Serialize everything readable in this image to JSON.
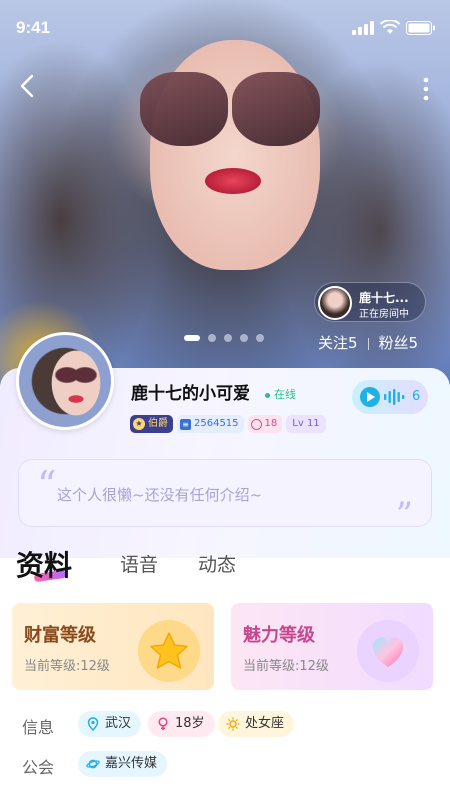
{
  "status_bar": {
    "time": "9:41"
  },
  "live": {
    "name": "鹿十七...",
    "status": "正在房间中"
  },
  "stats": {
    "follow": "关注5",
    "fans": "粉丝5"
  },
  "profile": {
    "nickname": "鹿十七的小可爱",
    "online": "在线",
    "badges": {
      "title": "伯爵",
      "id": "2564515",
      "age": "18",
      "level": "Lv 11"
    },
    "voice_seconds": "6",
    "intro": "这个人很懒~还没有任何介绍~"
  },
  "tabs": [
    "资料",
    "语音",
    "动态"
  ],
  "levels": {
    "wealth": {
      "title": "财富等级",
      "sub": "当前等级:12级"
    },
    "charm": {
      "title": "魅力等级",
      "sub": "当前等级:12级"
    }
  },
  "info": {
    "label": "信息",
    "city": "武汉",
    "age": "18岁",
    "zodiac": "处女座"
  },
  "guild": {
    "label": "公会",
    "name": "嘉兴传媒"
  },
  "colors": {
    "accent": "#1fb0e8",
    "online": "#27c28a",
    "tab_underline": "#ff5fa8"
  }
}
